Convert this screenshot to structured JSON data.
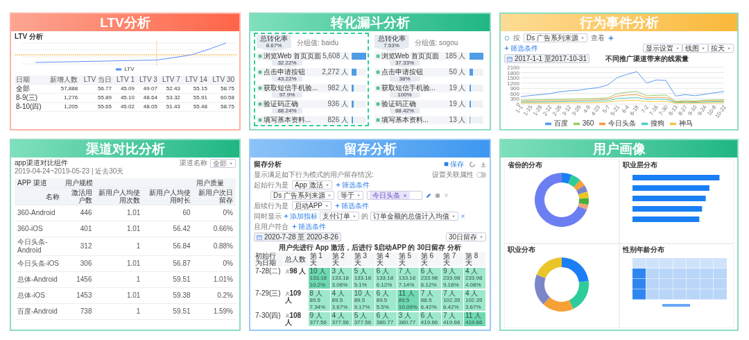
{
  "panels": [
    {
      "kind": "ltv",
      "title": "LTV分析",
      "screen": {
        "title": "LTV 分析",
        "legend": "LTV",
        "columns": [
          "日期",
          "新增人数",
          "LTV 当日",
          "LTV 1",
          "LTV 3",
          "LTV 7",
          "LTV 14",
          "LTV 30"
        ],
        "rows": [
          [
            "全部",
            "57,888",
            "56.77",
            "45.09",
            "49.07",
            "52.43",
            "55.15",
            "58.75"
          ],
          [
            "8-9(三)",
            "1,276",
            "55.89",
            "45.10",
            "48.64",
            "53.32",
            "55.91",
            "60.58"
          ],
          [
            "8-10(四)",
            "1,205",
            "55.65",
            "45.02",
            "48.05",
            "51.43",
            "55.48",
            "58.75"
          ]
        ]
      }
    },
    {
      "kind": "funnel",
      "title": "转化漏斗分析",
      "screen": {
        "groups": [
          {
            "highlighted": true,
            "rate_label": "总转化率",
            "rate": "8.67%",
            "group": "分组值: baidu",
            "conversions": [
              "32.22%",
              "43.22%",
              "97.9%",
              "88.24%"
            ],
            "steps": [
              {
                "name": "浏览Web 首页页面",
                "count": "5,608 人",
                "level": 1
              },
              {
                "name": "点击申请按钮",
                "count": "2,272 人",
                "level": 0.33
              },
              {
                "name": "获取短信手机验...",
                "count": "982 人",
                "level": 0.14
              },
              {
                "name": "验证码正确",
                "count": "936 人",
                "level": 0.13
              },
              {
                "name": "填写基本资料...",
                "count": "826 人",
                "level": 0.09
              }
            ]
          },
          {
            "highlighted": false,
            "rate_label": "总转化率",
            "rate": "7.53%",
            "group": "分组值: sogou",
            "conversions": [
              "37.33%",
              "38%",
              "100%",
              "88.42%"
            ],
            "steps": [
              {
                "name": "浏览Web 首页页面",
                "count": "185 人",
                "level": 1
              },
              {
                "name": "点击申请按钮",
                "count": "50 人",
                "level": 0.27
              },
              {
                "name": "获取短信手机验...",
                "count": "19 人",
                "level": 0.1
              },
              {
                "name": "验证码正确",
                "count": "19 人",
                "level": 0.1
              },
              {
                "name": "填写基本资料...",
                "count": "13 人",
                "level": 0.07
              }
            ]
          }
        ]
      }
    },
    {
      "kind": "event",
      "title": "行为事件分析",
      "screen": {
        "by_label": "按",
        "dimension": "Ds 广告系列来源",
        "view": "查看",
        "filter": "筛选条件",
        "date": "2017-1-1 至2017-10-31",
        "buttons": [
          "显示设置",
          "线图",
          "按天"
        ],
        "chart_data": {
          "type": "line",
          "title": "不同推广渠道带来的线索量",
          "grid": true,
          "x": [
            "1-1",
            "1-15",
            "1-29",
            "2-12",
            "2-26",
            "3-12",
            "3-26",
            "4-9",
            "4-23",
            "5-7",
            "5-21",
            "6-4",
            "6-18",
            "7-2",
            "7-16",
            "7-30",
            "8-13",
            "8-27",
            "9-10",
            "9-24",
            "10-8",
            "10-22"
          ],
          "ylim": [
            0,
            2100
          ],
          "yticks": [
            0,
            300,
            600,
            900,
            1200,
            1500,
            1800,
            2100
          ],
          "series": [
            {
              "name": "百度",
              "color": "#5b9bf0",
              "values": [
                420,
                490,
                540,
                600,
                700,
                760,
                790,
                880,
                940,
                1100,
                1520,
                1700,
                1850,
                1200,
                1380,
                1350,
                460,
                540,
                480,
                560,
                640,
                720
              ]
            },
            {
              "name": "360",
              "color": "#9ccc65",
              "values": [
                230,
                240,
                250,
                260,
                270,
                280,
                300,
                310,
                320,
                360,
                600,
                680,
                720,
                470,
                500,
                520,
                160,
                200,
                180,
                220,
                240,
                250
              ]
            },
            {
              "name": "今日头条",
              "color": "#f39c51",
              "values": [
                160,
                170,
                180,
                190,
                200,
                210,
                220,
                230,
                240,
                280,
                460,
                520,
                540,
                360,
                390,
                380,
                120,
                150,
                140,
                170,
                180,
                190
              ]
            },
            {
              "name": "搜狗",
              "color": "#4dd0c4",
              "values": [
                110,
                120,
                120,
                130,
                140,
                150,
                150,
                160,
                170,
                200,
                320,
                350,
                380,
                260,
                280,
                270,
                90,
                110,
                100,
                120,
                130,
                140
              ]
            },
            {
              "name": "神马",
              "color": "#f5c542",
              "values": [
                50,
                60,
                60,
                60,
                70,
                80,
                80,
                80,
                90,
                110,
                180,
                200,
                210,
                140,
                150,
                150,
                50,
                60,
                60,
                60,
                70,
                80
              ]
            }
          ]
        }
      }
    },
    {
      "kind": "channel",
      "title": "渠道对比分析",
      "screen": {
        "title": "app渠道对比组件",
        "date": "2019-04-24~2019-05-23 | 近去30天",
        "filter_label": "渠道名称",
        "filter_value": "全部",
        "groups": [
          "APP 渠道",
          "用户规模",
          "用户质量"
        ],
        "columns": [
          "名称",
          "激活用户数",
          "新用户人均使用次数",
          "新用户人均使用时长",
          "新用户次日留存"
        ],
        "rows": [
          [
            "360-Android",
            "446",
            "1.01",
            "60",
            "0%"
          ],
          [
            "360-iOS",
            "401",
            "1.01",
            "56.42",
            "0.66%"
          ],
          [
            "今日头条-Android",
            "312",
            "1",
            "56.84",
            "0.88%"
          ],
          [
            "今日头条-iOS",
            "306",
            "1.01",
            "56.87",
            "0%"
          ],
          [
            "总体-Android",
            "1456",
            "1",
            "59.51",
            "1.01%"
          ],
          [
            "总体-iOS",
            "1453",
            "1.01",
            "59.38",
            "0.2%"
          ],
          [
            "百度-Android",
            "738",
            "1",
            "59.51",
            "1.59%"
          ]
        ]
      }
    },
    {
      "kind": "retention",
      "title": "留存分析",
      "screen": {
        "title": "留存分析",
        "save": "保存",
        "description": "显示满足如下行为模式的用户留存情况:",
        "related": {
          "label": "设置关联属性",
          "on": false
        },
        "start_label": "起始行为是",
        "start_event": "App 激活",
        "start_filter": "筛选条件",
        "property": "Ds 广告系列来源",
        "operator": "等于",
        "value_tag": "今日头条",
        "next_label": "后续行为是",
        "next_event": "启动APP",
        "next_filter": "筛选条件",
        "also_label": "同时显示",
        "add_metric": "添加指标",
        "metric_event": "支付订单",
        "of": "的",
        "metric": "订单金额的总值计入均值",
        "user_label": "且用户符合",
        "user_filter": "筛选条件",
        "date": "2020-7-28 至 2020-8-26",
        "analysis_title": "用户先进行 App 激活，后进行 $启动APP 的 30日留存 分析",
        "mode": "30日留存",
        "columns": [
          "初始行为日期",
          "总人数",
          "第 1 天",
          "第 2 天",
          "第 3 天",
          "第 4 天",
          "第 5 天",
          "第 6 天",
          "第 7 天",
          "第 8 天"
        ],
        "rows": [
          [
            [
              "7-28(二)"
            ],
            [
              "98 人"
            ],
            [
              "10 人",
              "133.18",
              "10.2%"
            ],
            [
              "3 人",
              "133.18",
              "3.06%"
            ],
            [
              "5 人",
              "133.18",
              "5.1%"
            ],
            [
              "6 人",
              "133.18",
              "6.12%"
            ],
            [
              "7 人",
              "133.18",
              "7.14%"
            ],
            [
              "6 人",
              "233.98",
              "6.12%"
            ],
            [
              "9 人",
              "233.98",
              "9.18%"
            ],
            [
              "4 人",
              "233.98",
              "4.08%"
            ]
          ],
          [
            [
              "7-29(三)"
            ],
            [
              "109 人"
            ],
            [
              "8 人",
              "89.5",
              "7.34%"
            ],
            [
              "4 人",
              "89.5",
              "3.67%"
            ],
            [
              "10 人",
              "89.5",
              "9.17%"
            ],
            [
              "6 人",
              "89.5",
              "5.5%"
            ],
            [
              "11 人",
              "89.5",
              "10.09%"
            ],
            [
              "7 人",
              "88.5",
              "6.42%"
            ],
            [
              "7 人",
              "102.35",
              "6.42%"
            ],
            [
              "4 人",
              "102.35",
              "3.67%"
            ]
          ],
          [
            [
              "7-30(四)"
            ],
            [
              "108 人"
            ],
            [
              "9 人",
              "377.56"
            ],
            [
              "4 人",
              "377.56"
            ],
            [
              "5 人",
              "377.56"
            ],
            [
              "6 人",
              "380.77"
            ],
            [
              "3 人",
              "380.77"
            ],
            [
              "6 人",
              "419.66"
            ],
            [
              "7 人",
              "419.66"
            ],
            [
              "11 人",
              "419.66"
            ]
          ]
        ]
      }
    },
    {
      "kind": "profile",
      "title": "用户画像",
      "screen": {
        "charts": [
          {
            "kind": "donut",
            "title": "省份的分布"
          },
          {
            "kind": "bar",
            "title": "职业层分布"
          },
          {
            "kind": "donut",
            "title": "职业分布"
          },
          {
            "kind": "heatmap",
            "title": "性别年龄分布"
          }
        ]
      }
    }
  ]
}
